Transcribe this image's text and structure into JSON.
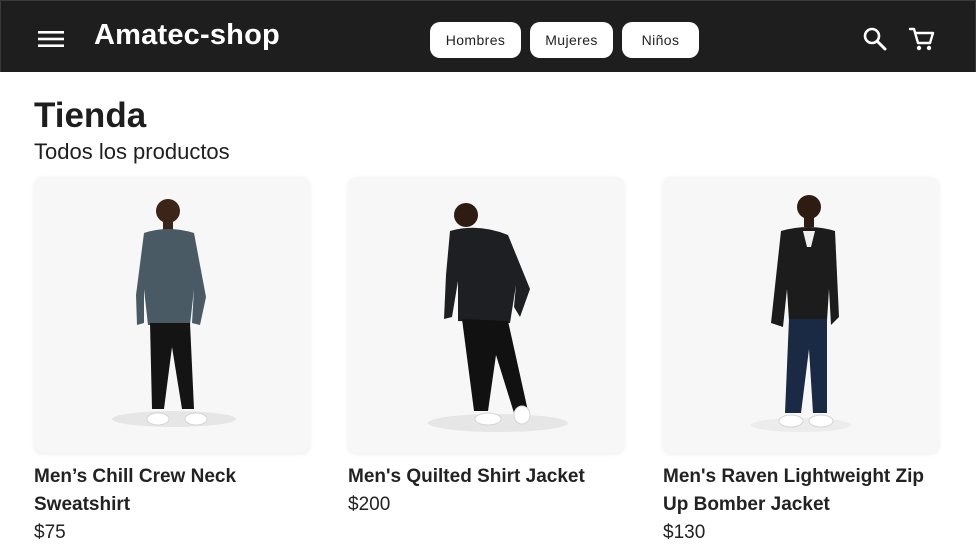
{
  "header": {
    "brand": "Amatec-shop",
    "menu_icon": "menu-icon",
    "search_icon": "search-icon",
    "cart_icon": "shopping-cart-icon",
    "background": "#1e1e1e",
    "nav": [
      {
        "label": "Hombres"
      },
      {
        "label": "Mujeres"
      },
      {
        "label": "Niños"
      }
    ]
  },
  "page": {
    "title": "Tienda",
    "subtitle": "Todos los productos"
  },
  "products": [
    {
      "title": "Men’s Chill Crew Neck Sweatshirt",
      "price": "$75",
      "top_color": "#4a5a64"
    },
    {
      "title": "Men's Quilted Shirt Jacket",
      "price": "$200",
      "top_color": "#1d1f22"
    },
    {
      "title": "Men's Raven Lightweight Zip Up Bomber Jacket",
      "price": "$130",
      "top_color": "#1c1c1c"
    }
  ]
}
